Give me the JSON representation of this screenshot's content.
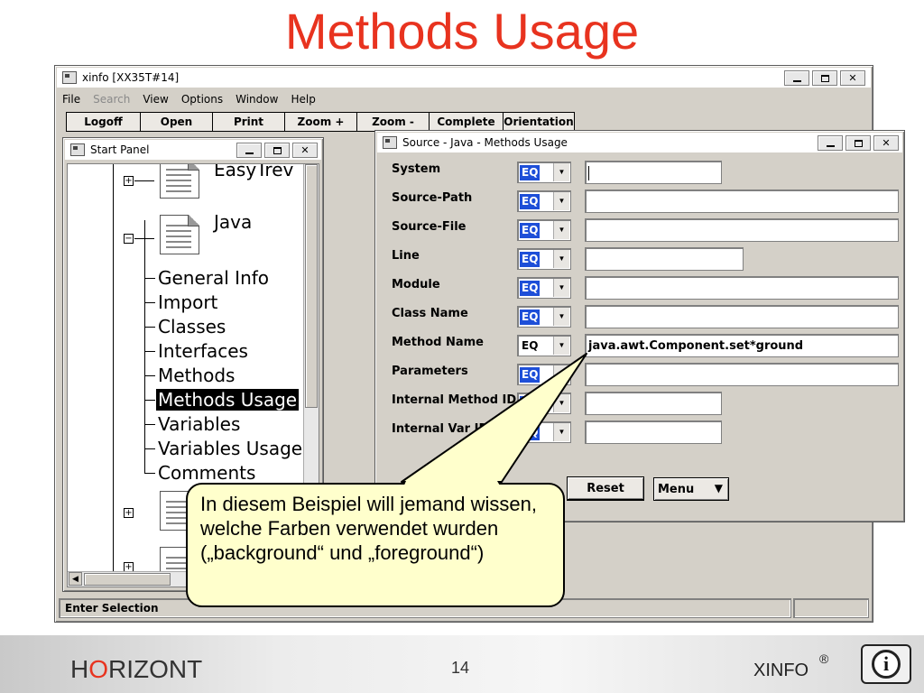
{
  "slide": {
    "title": "Methods Usage"
  },
  "main_window": {
    "title": "xinfo [XX35T#14]",
    "menu": [
      {
        "label": "File",
        "disabled": false
      },
      {
        "label": "Search",
        "disabled": true
      },
      {
        "label": "View",
        "disabled": false
      },
      {
        "label": "Options",
        "disabled": false
      },
      {
        "label": "Window",
        "disabled": false
      },
      {
        "label": "Help",
        "disabled": false
      }
    ],
    "toolbar": [
      "Logoff",
      "Open",
      "Print",
      "Zoom +",
      "Zoom -",
      "Complete",
      "Orientation"
    ],
    "status": "Enter Selection"
  },
  "start_panel": {
    "title": "Start Panel",
    "items": {
      "easytrev": "EasyTrev",
      "java": "Java",
      "general_info": "General Info",
      "import": "Import",
      "classes": "Classes",
      "interfaces": "Interfaces",
      "methods": "Methods",
      "methods_usage": "Methods Usage",
      "variables": "Variables",
      "variables_usage": "Variables Usage",
      "comments": "Comments"
    }
  },
  "source_window": {
    "title": "Source - Java - Methods Usage",
    "fields": [
      {
        "label": "System",
        "op": "EQ",
        "value": ""
      },
      {
        "label": "Source-Path",
        "op": "EQ",
        "value": ""
      },
      {
        "label": "Source-File",
        "op": "EQ",
        "value": ""
      },
      {
        "label": "Line",
        "op": "EQ",
        "value": ""
      },
      {
        "label": "Module",
        "op": "EQ",
        "value": ""
      },
      {
        "label": "Class Name",
        "op": "EQ",
        "value": ""
      },
      {
        "label": "Method Name",
        "op": "EQ",
        "value": "java.awt.Component.set*ground"
      },
      {
        "label": "Parameters",
        "op": "EQ",
        "value": ""
      },
      {
        "label": "Internal Method ID",
        "op": "EQ",
        "value": ""
      },
      {
        "label": "Internal Var ID",
        "op": "EQ",
        "value": ""
      }
    ],
    "buttons": {
      "reset": "Reset",
      "menu": "Menu"
    }
  },
  "callout": {
    "text": "In diesem Beispiel will jemand wissen, welche Farben verwendet wurden („background“ und „foreground“)"
  },
  "footer": {
    "brand_h": "H",
    "brand_o": "O",
    "brand_rest": "RIZONT",
    "page": "14",
    "product": "XINFO",
    "registered": "®"
  },
  "colors": {
    "title": "#e8331f",
    "selection": "#1e4fd8",
    "callout_fill": "#ffffcc"
  }
}
